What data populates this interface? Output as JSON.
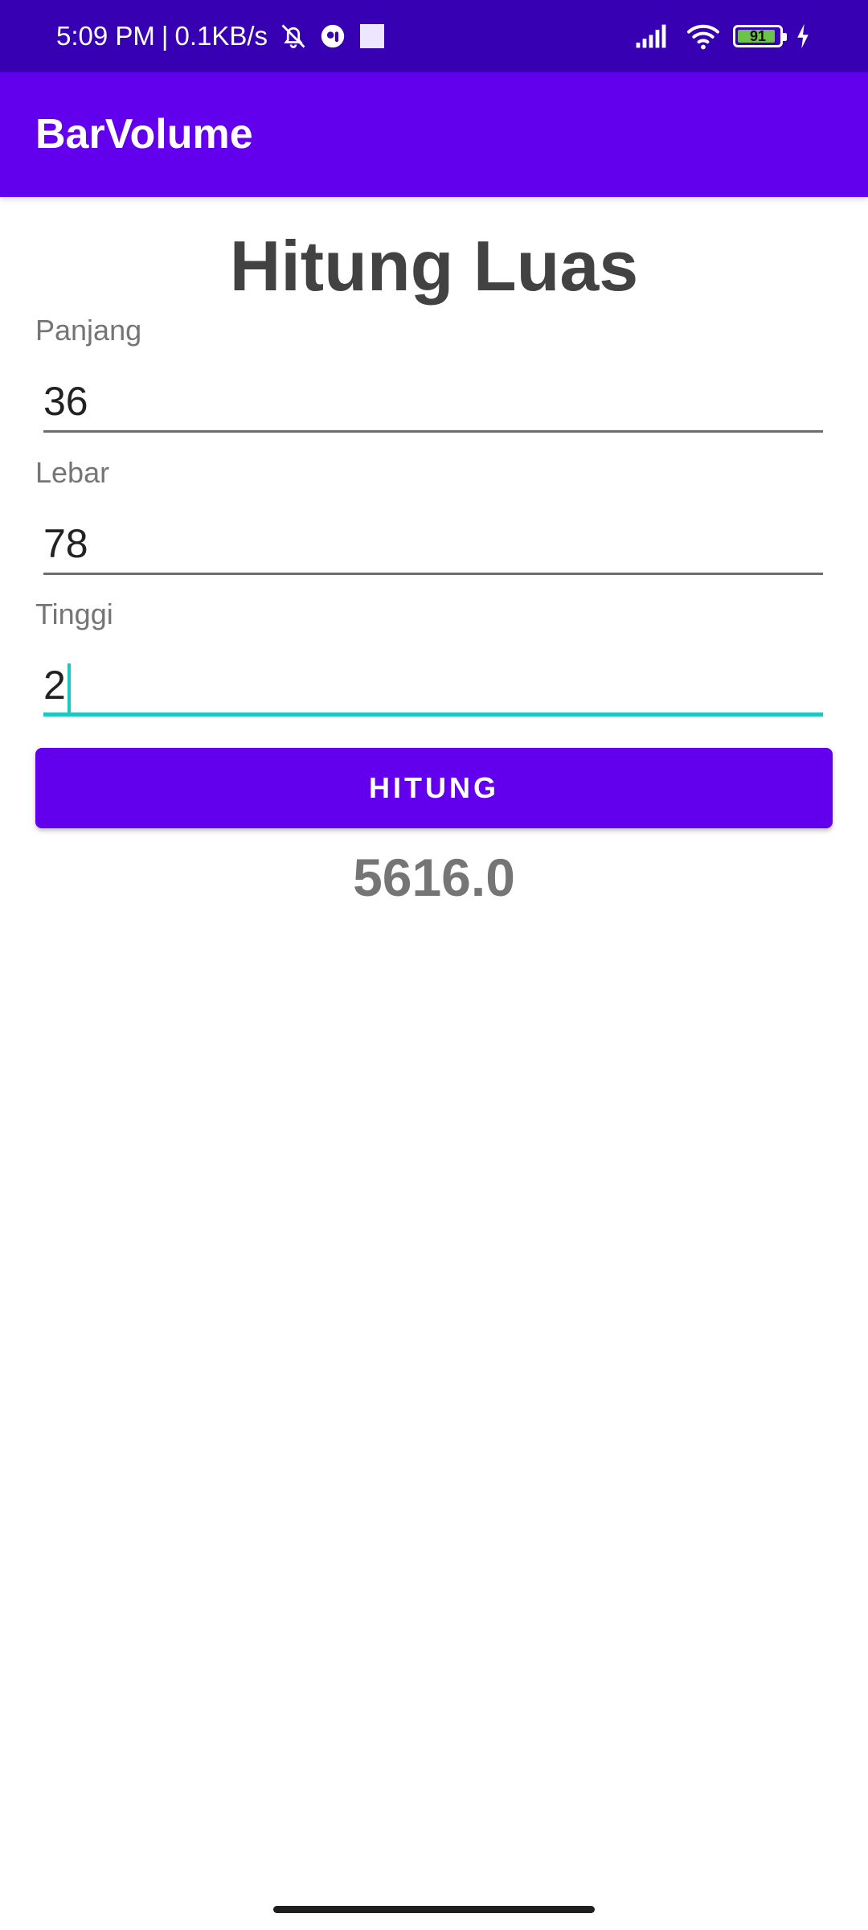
{
  "status_bar": {
    "time": "5:09 PM",
    "separator": "|",
    "network_speed": "0.1KB/s",
    "battery_level": "91",
    "icons": [
      "bell-off-icon",
      "messenger-icon",
      "square-icon",
      "signal-icon",
      "wifi-icon",
      "battery-icon",
      "charging-icon"
    ],
    "background_color": "#3700b3"
  },
  "app_bar": {
    "title": "BarVolume",
    "background_color": "#6200ee"
  },
  "main": {
    "heading": "Hitung Luas",
    "fields": [
      {
        "label": "Panjang",
        "value": "36"
      },
      {
        "label": "Lebar",
        "value": "78"
      },
      {
        "label": "Tinggi",
        "value": "2"
      }
    ],
    "button_label": "HITUNG",
    "result": "5616.0",
    "accent_color": "#1ec8c0"
  }
}
